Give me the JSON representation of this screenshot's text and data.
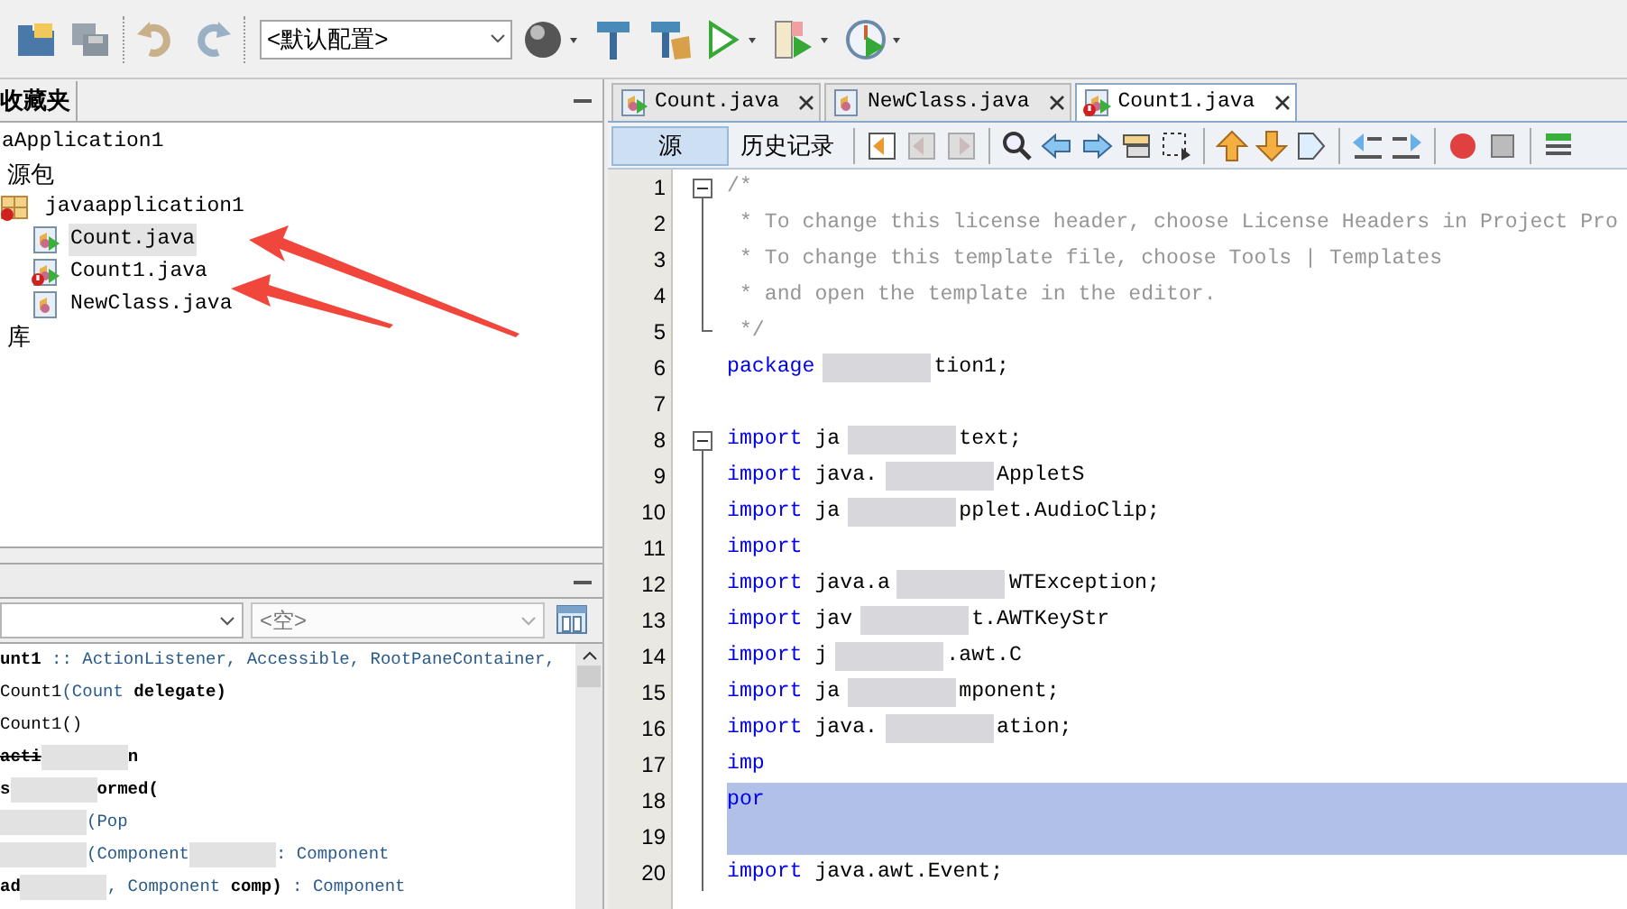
{
  "toolbar": {
    "config_dropdown": "<默认配置>"
  },
  "projects_panel": {
    "title": "收藏夹",
    "tree": [
      {
        "label": "aApplication1",
        "kind": "project",
        "children": [
          {
            "label": "源包",
            "kind": "folder",
            "children": [
              {
                "label": "javaapplication1",
                "kind": "package",
                "error": true,
                "children": [
                  {
                    "label": "Count.java",
                    "kind": "runnable",
                    "error": false,
                    "selected": true
                  },
                  {
                    "label": "Count1.java",
                    "kind": "runnable",
                    "error": true,
                    "selected": false
                  },
                  {
                    "label": "NewClass.java",
                    "kind": "class",
                    "error": false,
                    "selected": false
                  }
                ]
              }
            ]
          },
          {
            "label": "库",
            "kind": "folder"
          }
        ]
      }
    ]
  },
  "navigator": {
    "filter_2": "<空>",
    "members": [
      {
        "parts": [
          {
            "kind": "name",
            "text": "unt1",
            "blurred_before": false
          },
          {
            "kind": "type",
            "text": " :: ActionListener, Accessible, RootPaneContainer,",
            "blurred_before": false
          }
        ]
      },
      {
        "parts": [
          {
            "kind": "plain",
            "text": "Count1",
            "blurred_before": false
          },
          {
            "kind": "type",
            "text": "(Count ",
            "blurred_before": false
          },
          {
            "kind": "name",
            "text": "delegate)",
            "blurred_before": false
          }
        ]
      },
      {
        "parts": [
          {
            "kind": "plain",
            "text": "Count1()",
            "blurred_before": false
          }
        ]
      },
      {
        "parts": [
          {
            "kind": "deprecated",
            "text": "acti",
            "blurred_before": false
          },
          {
            "kind": "name",
            "text": "n",
            "blurred_before": true
          }
        ]
      },
      {
        "parts": [
          {
            "kind": "name",
            "text": "s",
            "blurred_before": false
          },
          {
            "kind": "name",
            "text": "ormed(",
            "blurred_before": true
          }
        ]
      },
      {
        "parts": [
          {
            "kind": "type",
            "text": "(Pop",
            "blurred_before": true
          }
        ]
      },
      {
        "parts": [
          {
            "kind": "type",
            "text": "(Component",
            "blurred_before": true
          },
          {
            "kind": "type",
            "text": ": Component",
            "blurred_before": true
          }
        ]
      },
      {
        "parts": [
          {
            "kind": "name",
            "text": "ad",
            "blurred_before": false
          },
          {
            "kind": "type",
            "text": ", Component ",
            "blurred_before": true
          },
          {
            "kind": "name",
            "text": "comp)",
            "blurred_before": false
          },
          {
            "kind": "type",
            "text": " : Component",
            "blurred_before": false
          }
        ]
      }
    ]
  },
  "editor": {
    "tabs": [
      {
        "label": "Count.java",
        "kind": "runnable",
        "error": false,
        "selected": false
      },
      {
        "label": "NewClass.java",
        "kind": "class",
        "error": false,
        "selected": false
      },
      {
        "label": "Count1.java",
        "kind": "runnable",
        "error": true,
        "selected": true
      }
    ],
    "view_tabs": [
      {
        "label": "源",
        "selected": true
      },
      {
        "label": "历史记录",
        "selected": false
      }
    ],
    "lines": [
      {
        "number": "1",
        "foldable": true,
        "fold_end": false,
        "selected": false,
        "segments": [
          {
            "kind": "comment",
            "text": "/*",
            "blurred_before": false
          }
        ]
      },
      {
        "number": "2",
        "foldable": false,
        "fold_end": false,
        "selected": false,
        "segments": [
          {
            "kind": "comment",
            "text": " * To change this license header, choose License Headers in Project Pro",
            "blurred_before": false
          }
        ]
      },
      {
        "number": "3",
        "foldable": false,
        "fold_end": false,
        "selected": false,
        "segments": [
          {
            "kind": "comment",
            "text": " * To change this template file, choose Tools | Templates",
            "blurred_before": false
          }
        ]
      },
      {
        "number": "4",
        "foldable": false,
        "fold_end": false,
        "selected": false,
        "segments": [
          {
            "kind": "comment",
            "text": " * and open the template in the editor.",
            "blurred_before": false
          }
        ]
      },
      {
        "number": "5",
        "foldable": false,
        "fold_end": true,
        "selected": false,
        "segments": [
          {
            "kind": "comment",
            "text": " */",
            "blurred_before": false
          }
        ]
      },
      {
        "number": "6",
        "foldable": false,
        "fold_end": false,
        "selected": false,
        "segments": [
          {
            "kind": "keyword",
            "text": "package",
            "blurred_before": false
          },
          {
            "kind": "plain",
            "text": "tion1;",
            "blurred_before": true
          }
        ]
      },
      {
        "number": "7",
        "foldable": false,
        "fold_end": false,
        "selected": false
      },
      {
        "number": "8",
        "foldable": true,
        "fold_end": false,
        "selected": false,
        "segments": [
          {
            "kind": "keyword",
            "text": "import",
            "blurred_before": false
          },
          {
            "kind": "plain",
            "text": "ja",
            "blurred_before": false
          },
          {
            "kind": "plain",
            "text": "text;",
            "blurred_before": true
          }
        ]
      },
      {
        "number": "9",
        "foldable": false,
        "fold_end": false,
        "selected": false,
        "segments": [
          {
            "kind": "keyword",
            "text": "import",
            "blurred_before": false
          },
          {
            "kind": "plain",
            "text": "java.",
            "blurred_before": false
          },
          {
            "kind": "plain",
            "text": "AppletS",
            "blurred_before": true
          }
        ]
      },
      {
        "number": "10",
        "foldable": false,
        "fold_end": false,
        "selected": false,
        "segments": [
          {
            "kind": "keyword",
            "text": "import",
            "blurred_before": false
          },
          {
            "kind": "plain",
            "text": "ja",
            "blurred_before": false
          },
          {
            "kind": "plain",
            "text": "pplet.AudioClip;",
            "blurred_before": true
          }
        ]
      },
      {
        "number": "11",
        "foldable": false,
        "fold_end": false,
        "selected": false,
        "segments": [
          {
            "kind": "keyword",
            "text": "import",
            "blurred_before": false
          }
        ]
      },
      {
        "number": "12",
        "foldable": false,
        "fold_end": false,
        "selected": false,
        "segments": [
          {
            "kind": "keyword",
            "text": "import",
            "blurred_before": false
          },
          {
            "kind": "plain",
            "text": "java.a",
            "blurred_before": false
          },
          {
            "kind": "plain",
            "text": "WTException;",
            "blurred_before": true
          }
        ]
      },
      {
        "number": "13",
        "foldable": false,
        "fold_end": false,
        "selected": false,
        "segments": [
          {
            "kind": "keyword",
            "text": "import",
            "blurred_before": false
          },
          {
            "kind": "plain",
            "text": "jav",
            "blurred_before": false
          },
          {
            "kind": "plain",
            "text": "t.AWTKeyStr",
            "blurred_before": true
          }
        ]
      },
      {
        "number": "14",
        "foldable": false,
        "fold_end": false,
        "selected": false,
        "segments": [
          {
            "kind": "keyword",
            "text": "import",
            "blurred_before": false
          },
          {
            "kind": "plain",
            "text": "j",
            "blurred_before": false
          },
          {
            "kind": "plain",
            "text": ".awt.C",
            "blurred_before": true
          }
        ]
      },
      {
        "number": "15",
        "foldable": false,
        "fold_end": false,
        "selected": false,
        "segments": [
          {
            "kind": "keyword",
            "text": "import",
            "blurred_before": false
          },
          {
            "kind": "plain",
            "text": "ja",
            "blurred_before": false
          },
          {
            "kind": "plain",
            "text": "mponent;",
            "blurred_before": true
          }
        ]
      },
      {
        "number": "16",
        "foldable": false,
        "fold_end": false,
        "selected": false,
        "segments": [
          {
            "kind": "keyword",
            "text": "import",
            "blurred_before": false
          },
          {
            "kind": "plain",
            "text": "java.",
            "blurred_before": false
          },
          {
            "kind": "plain",
            "text": "ation;",
            "blurred_before": true
          }
        ]
      },
      {
        "number": "17",
        "foldable": false,
        "fold_end": false,
        "selected": false,
        "segments": [
          {
            "kind": "keyword",
            "text": "imp",
            "blurred_before": false
          }
        ]
      },
      {
        "number": "18",
        "foldable": false,
        "fold_end": false,
        "selected": true,
        "segments": [
          {
            "kind": "keyword",
            "text": "por",
            "blurred_before": false
          }
        ]
      },
      {
        "number": "19",
        "foldable": false,
        "fold_end": false,
        "selected": true
      },
      {
        "number": "20",
        "foldable": false,
        "fold_end": false,
        "selected": false,
        "segments": [
          {
            "kind": "keyword",
            "text": "import",
            "blurred_before": false
          },
          {
            "kind": "plain",
            "text": "java.awt.Event;",
            "blurred_before": false
          }
        ]
      }
    ]
  }
}
